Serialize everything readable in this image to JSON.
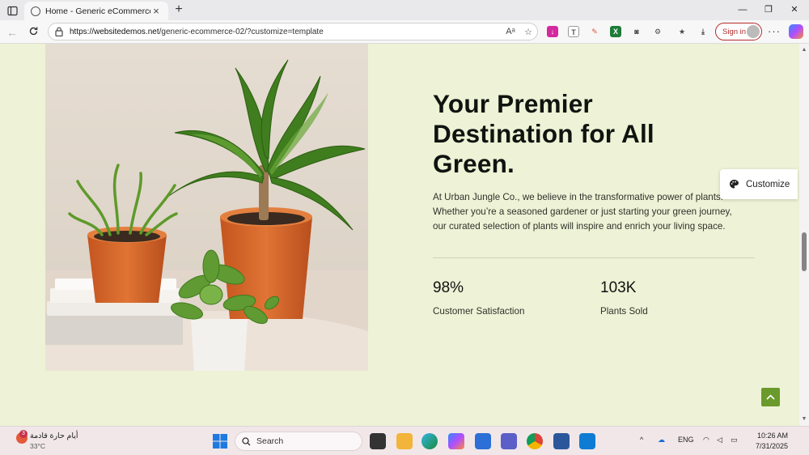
{
  "browser": {
    "tab_title": "Home - Generic eCommerce",
    "new_tab": "+",
    "url_host": "https://websitedemos.net",
    "url_path": "/generic-ecommerce-02/?customize=template",
    "sign_in": "Sign in",
    "window_controls": {
      "minimize": "—",
      "restore": "❐",
      "close": "✕"
    }
  },
  "hero": {
    "headline_line1": "Your Premier",
    "headline_line2": "Destination for All",
    "headline_line3": "Green.",
    "paragraph_line1": "At Urban Jungle Co., we believe in the transformative power of plants.",
    "paragraph_line2": "Whether you’re a seasoned gardener or just starting your green journey,",
    "paragraph_line3": "our curated selection of plants will inspire and enrich your living space.",
    "stats": [
      {
        "value": "98%",
        "label": "Customer Satisfaction"
      },
      {
        "value": "103K",
        "label": "Plants Sold"
      }
    ]
  },
  "customize_button": "Customize",
  "scroll_position": 0.5,
  "taskbar": {
    "weather_text": "أيام حارة قادمة",
    "weather_temp": "33°C",
    "weather_badge": "3",
    "search_label": "Search",
    "lang": "ENG",
    "time": "10:26 AM",
    "date": "7/31/2025"
  },
  "colors": {
    "page_bg": "#eef2d6",
    "accent_green": "#6a9a2c",
    "pot_orange": "#d4622a",
    "signin_red": "#b22a2a"
  }
}
